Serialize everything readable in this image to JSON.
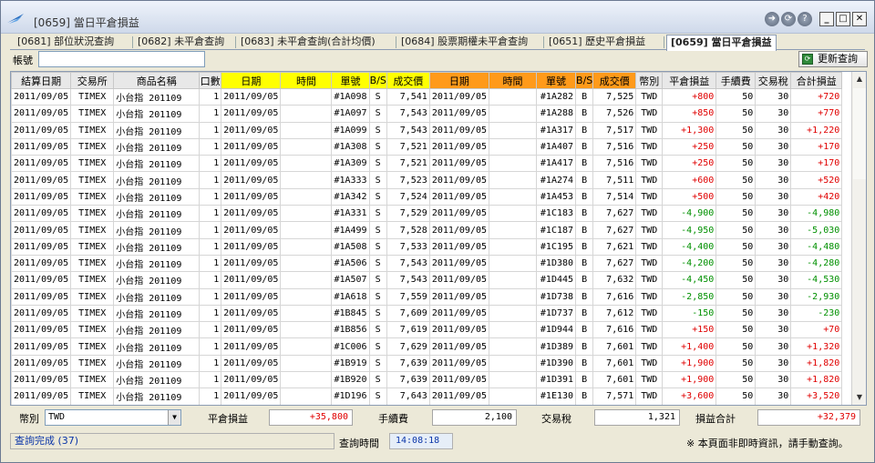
{
  "window": {
    "title": "[0659] 當日平倉損益",
    "logo_icon": "wing-logo-icon",
    "title_buttons": [
      "forward-icon",
      "refresh-circle-icon",
      "help-icon"
    ],
    "window_controls": [
      "minimize-icon",
      "maximize-icon",
      "close-icon"
    ]
  },
  "tabs": [
    {
      "label": "[0681] 部位狀況查詢",
      "active": false
    },
    {
      "label": "[0682] 未平倉查詢",
      "active": false
    },
    {
      "label": "[0683] 未平倉查詢(合計均價)",
      "active": false
    },
    {
      "label": "[0684] 股票期權未平倉查詢",
      "active": false
    },
    {
      "label": "[0651] 歷史平倉損益",
      "active": false
    },
    {
      "label": "[0659] 當日平倉損益",
      "active": true
    }
  ],
  "toolbar": {
    "account_label": "帳號",
    "account_value": "",
    "refresh_label": "更新查詢"
  },
  "grid": {
    "columns": [
      "結算日期",
      "交易所",
      "商品名稱",
      "口數",
      "日期",
      "時間",
      "單號",
      "B/S",
      "成交價",
      "日期",
      "時間",
      "單號",
      "B/S",
      "成交價",
      "幣別",
      "平倉損益",
      "手續費",
      "交易稅",
      "合計損益"
    ],
    "header_colors": {
      "open_leg": "#ffff00",
      "close_leg": "#ff9a1a"
    },
    "rows": [
      [
        "2011/09/05",
        "TIMEX",
        "小台指 201109",
        "1",
        "2011/09/05",
        "",
        "#1A098",
        "S",
        "7,541",
        "2011/09/05",
        "",
        "#1A282",
        "B",
        "7,525",
        "TWD",
        "+800",
        "50",
        "30",
        "+720"
      ],
      [
        "2011/09/05",
        "TIMEX",
        "小台指 201109",
        "1",
        "2011/09/05",
        "",
        "#1A097",
        "S",
        "7,543",
        "2011/09/05",
        "",
        "#1A288",
        "B",
        "7,526",
        "TWD",
        "+850",
        "50",
        "30",
        "+770"
      ],
      [
        "2011/09/05",
        "TIMEX",
        "小台指 201109",
        "1",
        "2011/09/05",
        "",
        "#1A099",
        "S",
        "7,543",
        "2011/09/05",
        "",
        "#1A317",
        "B",
        "7,517",
        "TWD",
        "+1,300",
        "50",
        "30",
        "+1,220"
      ],
      [
        "2011/09/05",
        "TIMEX",
        "小台指 201109",
        "1",
        "2011/09/05",
        "",
        "#1A308",
        "S",
        "7,521",
        "2011/09/05",
        "",
        "#1A407",
        "B",
        "7,516",
        "TWD",
        "+250",
        "50",
        "30",
        "+170"
      ],
      [
        "2011/09/05",
        "TIMEX",
        "小台指 201109",
        "1",
        "2011/09/05",
        "",
        "#1A309",
        "S",
        "7,521",
        "2011/09/05",
        "",
        "#1A417",
        "B",
        "7,516",
        "TWD",
        "+250",
        "50",
        "30",
        "+170"
      ],
      [
        "2011/09/05",
        "TIMEX",
        "小台指 201109",
        "1",
        "2011/09/05",
        "",
        "#1A333",
        "S",
        "7,523",
        "2011/09/05",
        "",
        "#1A274",
        "B",
        "7,511",
        "TWD",
        "+600",
        "50",
        "30",
        "+520"
      ],
      [
        "2011/09/05",
        "TIMEX",
        "小台指 201109",
        "1",
        "2011/09/05",
        "",
        "#1A342",
        "S",
        "7,524",
        "2011/09/05",
        "",
        "#1A453",
        "B",
        "7,514",
        "TWD",
        "+500",
        "50",
        "30",
        "+420"
      ],
      [
        "2011/09/05",
        "TIMEX",
        "小台指 201109",
        "1",
        "2011/09/05",
        "",
        "#1A331",
        "S",
        "7,529",
        "2011/09/05",
        "",
        "#1C183",
        "B",
        "7,627",
        "TWD",
        "-4,900",
        "50",
        "30",
        "-4,980"
      ],
      [
        "2011/09/05",
        "TIMEX",
        "小台指 201109",
        "1",
        "2011/09/05",
        "",
        "#1A499",
        "S",
        "7,528",
        "2011/09/05",
        "",
        "#1C187",
        "B",
        "7,627",
        "TWD",
        "-4,950",
        "50",
        "30",
        "-5,030"
      ],
      [
        "2011/09/05",
        "TIMEX",
        "小台指 201109",
        "1",
        "2011/09/05",
        "",
        "#1A508",
        "S",
        "7,533",
        "2011/09/05",
        "",
        "#1C195",
        "B",
        "7,621",
        "TWD",
        "-4,400",
        "50",
        "30",
        "-4,480"
      ],
      [
        "2011/09/05",
        "TIMEX",
        "小台指 201109",
        "1",
        "2011/09/05",
        "",
        "#1A506",
        "S",
        "7,543",
        "2011/09/05",
        "",
        "#1D380",
        "B",
        "7,627",
        "TWD",
        "-4,200",
        "50",
        "30",
        "-4,280"
      ],
      [
        "2011/09/05",
        "TIMEX",
        "小台指 201109",
        "1",
        "2011/09/05",
        "",
        "#1A507",
        "S",
        "7,543",
        "2011/09/05",
        "",
        "#1D445",
        "B",
        "7,632",
        "TWD",
        "-4,450",
        "50",
        "30",
        "-4,530"
      ],
      [
        "2011/09/05",
        "TIMEX",
        "小台指 201109",
        "1",
        "2011/09/05",
        "",
        "#1A618",
        "S",
        "7,559",
        "2011/09/05",
        "",
        "#1D738",
        "B",
        "7,616",
        "TWD",
        "-2,850",
        "50",
        "30",
        "-2,930"
      ],
      [
        "2011/09/05",
        "TIMEX",
        "小台指 201109",
        "1",
        "2011/09/05",
        "",
        "#1B845",
        "S",
        "7,609",
        "2011/09/05",
        "",
        "#1D737",
        "B",
        "7,612",
        "TWD",
        "-150",
        "50",
        "30",
        "-230"
      ],
      [
        "2011/09/05",
        "TIMEX",
        "小台指 201109",
        "1",
        "2011/09/05",
        "",
        "#1B856",
        "S",
        "7,619",
        "2011/09/05",
        "",
        "#1D944",
        "B",
        "7,616",
        "TWD",
        "+150",
        "50",
        "30",
        "+70"
      ],
      [
        "2011/09/05",
        "TIMEX",
        "小台指 201109",
        "1",
        "2011/09/05",
        "",
        "#1C006",
        "S",
        "7,629",
        "2011/09/05",
        "",
        "#1D389",
        "B",
        "7,601",
        "TWD",
        "+1,400",
        "50",
        "30",
        "+1,320"
      ],
      [
        "2011/09/05",
        "TIMEX",
        "小台指 201109",
        "1",
        "2011/09/05",
        "",
        "#1B919",
        "S",
        "7,639",
        "2011/09/05",
        "",
        "#1D390",
        "B",
        "7,601",
        "TWD",
        "+1,900",
        "50",
        "30",
        "+1,820"
      ],
      [
        "2011/09/05",
        "TIMEX",
        "小台指 201109",
        "1",
        "2011/09/05",
        "",
        "#1B920",
        "S",
        "7,639",
        "2011/09/05",
        "",
        "#1D391",
        "B",
        "7,601",
        "TWD",
        "+1,900",
        "50",
        "30",
        "+1,820"
      ],
      [
        "2011/09/05",
        "TIMEX",
        "小台指 201109",
        "1",
        "2011/09/05",
        "",
        "#1D196",
        "S",
        "7,643",
        "2011/09/05",
        "",
        "#1E130",
        "B",
        "7,571",
        "TWD",
        "+3,600",
        "50",
        "30",
        "+3,520"
      ]
    ]
  },
  "summary": {
    "currency_label": "幣別",
    "currency_value": "TWD",
    "pnl_label": "平倉損益",
    "pnl_value": "+35,800",
    "fee_label": "手續費",
    "fee_value": "2,100",
    "tax_label": "交易稅",
    "tax_value": "1,321",
    "total_label": "損益合計",
    "total_value": "+32,379"
  },
  "status": {
    "message": "查詢完成 (37)",
    "time_label": "查詢時間",
    "time_value": "14:08:18",
    "note": "※ 本頁面非即時資訊，請手動查詢。"
  },
  "colors": {
    "positive": "#e00000",
    "negative": "#009000",
    "status_text": "#0a35a8"
  }
}
